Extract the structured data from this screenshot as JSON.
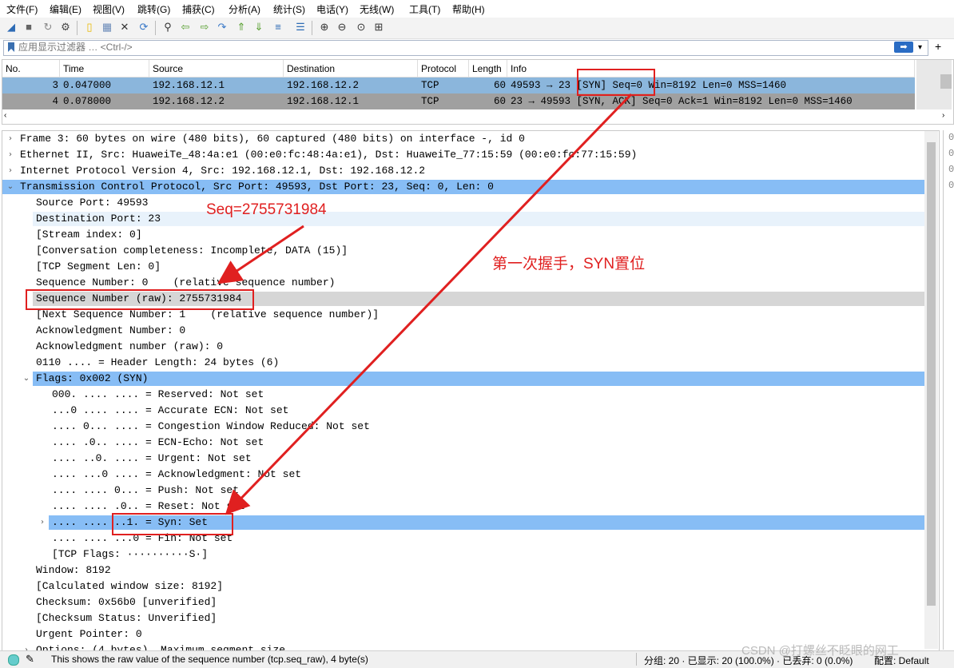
{
  "menu": [
    "文件(F)",
    "编辑(E)",
    "视图(V)",
    "跳转(G)",
    "捕获(C)",
    "分析(A)",
    "统计(S)",
    "电话(Y)",
    "无线(W)",
    "工具(T)",
    "帮助(H)"
  ],
  "toolbar": {
    "icons": [
      "shark-start-icon",
      "stop-icon",
      "restart-icon",
      "options-icon",
      "open-file-icon",
      "save-icon",
      "close-file-icon",
      "reload-icon",
      "find-icon",
      "back-icon",
      "forward-icon",
      "goto-icon",
      "first-icon",
      "last-icon",
      "autoscroll-icon",
      "colorize-icon",
      "zoom-in-icon",
      "zoom-out-icon",
      "zoom-normal-icon",
      "resize-columns-icon"
    ]
  },
  "filter": {
    "placeholder": "应用显示过滤器 … <Ctrl-/>",
    "apply_glyph": "➡",
    "dropdown_glyph": "▾",
    "add_glyph": "+"
  },
  "packet_list": {
    "columns": [
      "No.",
      "Time",
      "Source",
      "Destination",
      "Protocol",
      "Length",
      "Info"
    ],
    "rows": [
      {
        "no": "3",
        "time": "0.047000",
        "source": "192.168.12.1",
        "destination": "192.168.12.2",
        "protocol": "TCP",
        "length": "60",
        "info": "49593 → 23 [SYN] Seq=0 Win=8192 Len=0 MSS=1460"
      },
      {
        "no": "4",
        "time": "0.078000",
        "source": "192.168.12.2",
        "destination": "192.168.12.1",
        "protocol": "TCP",
        "length": "60",
        "info": "23 → 49593 [SYN, ACK] Seq=0 Ack=1 Win=8192 Len=0 MSS=1460"
      }
    ]
  },
  "details": [
    {
      "text": "Frame 3: 60 bytes on wire (480 bits), 60 captured (480 bits) on interface -, id 0",
      "indent": 0,
      "exp": "›",
      "hl": ""
    },
    {
      "text": "Ethernet II, Src: HuaweiTe_48:4a:e1 (00:e0:fc:48:4a:e1), Dst: HuaweiTe_77:15:59 (00:e0:fc:77:15:59)",
      "indent": 0,
      "exp": "›",
      "hl": ""
    },
    {
      "text": "Internet Protocol Version 4, Src: 192.168.12.1, Dst: 192.168.12.2",
      "indent": 0,
      "exp": "›",
      "hl": ""
    },
    {
      "text": "Transmission Control Protocol, Src Port: 49593, Dst Port: 23, Seq: 0, Len: 0",
      "indent": 0,
      "exp": "⌄",
      "hl": "blue"
    },
    {
      "text": "Source Port: 49593",
      "indent": 1,
      "exp": "",
      "hl": ""
    },
    {
      "text": "Destination Port: 23",
      "indent": 1,
      "exp": "",
      "hl": "light"
    },
    {
      "text": "[Stream index: 0]",
      "indent": 1,
      "exp": "",
      "hl": ""
    },
    {
      "text": "[Conversation completeness: Incomplete, DATA (15)]",
      "indent": 1,
      "exp": "",
      "hl": ""
    },
    {
      "text": "[TCP Segment Len: 0]",
      "indent": 1,
      "exp": "",
      "hl": ""
    },
    {
      "text": "Sequence Number: 0    (relative sequence number)",
      "indent": 1,
      "exp": "",
      "hl": ""
    },
    {
      "text": "Sequence Number (raw): 2755731984",
      "indent": 1,
      "exp": "",
      "hl": "gray"
    },
    {
      "text": "[Next Sequence Number: 1    (relative sequence number)]",
      "indent": 1,
      "exp": "",
      "hl": ""
    },
    {
      "text": "Acknowledgment Number: 0",
      "indent": 1,
      "exp": "",
      "hl": ""
    },
    {
      "text": "Acknowledgment number (raw): 0",
      "indent": 1,
      "exp": "",
      "hl": ""
    },
    {
      "text": "0110 .... = Header Length: 24 bytes (6)",
      "indent": 1,
      "exp": "",
      "hl": ""
    },
    {
      "text": "Flags: 0x002 (SYN)",
      "indent": 1,
      "exp": "⌄",
      "hl": "blue"
    },
    {
      "text": "000. .... .... = Reserved: Not set",
      "indent": 2,
      "exp": "",
      "hl": ""
    },
    {
      "text": "...0 .... .... = Accurate ECN: Not set",
      "indent": 2,
      "exp": "",
      "hl": ""
    },
    {
      "text": ".... 0... .... = Congestion Window Reduced: Not set",
      "indent": 2,
      "exp": "",
      "hl": ""
    },
    {
      "text": ".... .0.. .... = ECN-Echo: Not set",
      "indent": 2,
      "exp": "",
      "hl": ""
    },
    {
      "text": ".... ..0. .... = Urgent: Not set",
      "indent": 2,
      "exp": "",
      "hl": ""
    },
    {
      "text": ".... ...0 .... = Acknowledgment: Not set",
      "indent": 2,
      "exp": "",
      "hl": ""
    },
    {
      "text": ".... .... 0... = Push: Not set",
      "indent": 2,
      "exp": "",
      "hl": ""
    },
    {
      "text": ".... .... .0.. = Reset: Not set",
      "indent": 2,
      "exp": "",
      "hl": ""
    },
    {
      "text": ".... .... ..1. = Syn: Set",
      "indent": 2,
      "exp": "›",
      "hl": "blue"
    },
    {
      "text": ".... .... ...0 = Fin: Not set",
      "indent": 2,
      "exp": "",
      "hl": ""
    },
    {
      "text": "[TCP Flags: ··········S·]",
      "indent": 2,
      "exp": "",
      "hl": ""
    },
    {
      "text": "Window: 8192",
      "indent": 1,
      "exp": "",
      "hl": ""
    },
    {
      "text": "[Calculated window size: 8192]",
      "indent": 1,
      "exp": "",
      "hl": ""
    },
    {
      "text": "Checksum: 0x56b0 [unverified]",
      "indent": 1,
      "exp": "",
      "hl": ""
    },
    {
      "text": "[Checksum Status: Unverified]",
      "indent": 1,
      "exp": "",
      "hl": ""
    },
    {
      "text": "Urgent Pointer: 0",
      "indent": 1,
      "exp": "",
      "hl": ""
    },
    {
      "text": "Options: (4 bytes), Maximum segment size",
      "indent": 1,
      "exp": "›",
      "hl": ""
    }
  ],
  "bytes_pane": [
    "0",
    "0",
    "0",
    "0"
  ],
  "annotations": {
    "seq_label": "Seq=2755731984",
    "handshake_label": "第一次握手，SYN置位"
  },
  "status": {
    "message": "This shows the raw value of the sequence number (tcp.seq_raw), 4 byte(s)",
    "packets": "分组: 20 · 已显示: 20 (100.0%) · 已丢弃: 0 (0.0%)",
    "profile": "配置: Default",
    "watermark": "CSDN @打螺丝不眨眼的网工"
  },
  "colors": {
    "selected_row": "#8bb6dc",
    "row_gray": "#a0a0a0",
    "highlight_blue": "#87bdf5",
    "annotation_red": "#e02020"
  }
}
